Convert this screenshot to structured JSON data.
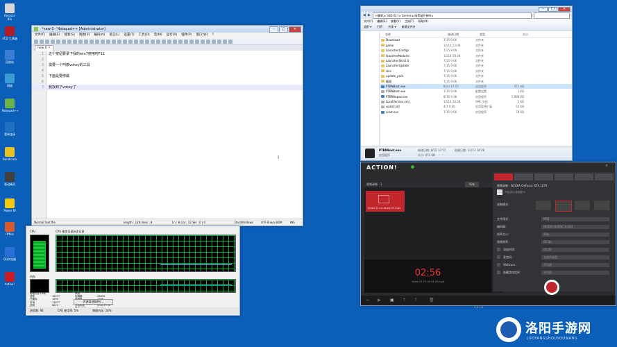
{
  "desktop": {
    "icons": [
      {
        "label": "Recycle Bin",
        "color": "#d8d8d8"
      },
      {
        "label": "ACD 工具箱",
        "color": "#b31b25"
      },
      {
        "label": "回收站",
        "color": "#3a7bd5"
      },
      {
        "label": "网络",
        "color": "#3a9bd5"
      },
      {
        "label": "Notepad++",
        "color": "#6bb34a"
      },
      {
        "label": "宽带连接",
        "color": "#1f6fc2"
      },
      {
        "label": "Bandicam",
        "color": "#e8c020"
      },
      {
        "label": "驱动精灵",
        "color": "#404040"
      },
      {
        "label": "Power BI",
        "color": "#f2c811"
      },
      {
        "label": "Office",
        "color": "#d65a2b"
      },
      {
        "label": "QQ浏览器",
        "color": "#2a6ed8"
      },
      {
        "label": "Action!",
        "color": "#c81c22"
      }
    ]
  },
  "notepad": {
    "title": "*new 0 - Notepad++ [Administrator]",
    "menu": [
      "文件(F)",
      "编辑(E)",
      "搜索(S)",
      "视图(V)",
      "编码(N)",
      "语言(L)",
      "设置(T)",
      "工具(O)",
      "宏(M)",
      "运行(R)",
      "插件(P)",
      "窗口(W)",
      "?"
    ],
    "tab": "new 0",
    "lines": [
      {
        "n": "1",
        "text": "这个按钮要录下我的win7使用时F11"
      },
      {
        "n": "2",
        "text": ""
      },
      {
        "n": "3",
        "text": "需要一个叫做vokey的工具"
      },
      {
        "n": "4",
        "text": ""
      },
      {
        "n": "5",
        "text": "下面是要修磁"
      },
      {
        "n": "6",
        "text": ""
      },
      {
        "n": "7",
        "text": "我找到了vokey了"
      }
    ],
    "status": {
      "type": "Normal text file",
      "length": "length : 126    lines : 8",
      "pos": "Ln : 8    Col : 12    Sel : 0 | 0",
      "eol": "Dos\\Windows",
      "enc": "UTF-8 w/o BOM",
      "mode": "INS"
    }
  },
  "taskmgr": {
    "cpu_label": "CPU",
    "history_label": "CPU 使用记录历史记录",
    "mem_label": "内存",
    "mem_history_label": "物理内存使用记录",
    "stats_left": [
      {
        "k": "物理内存 (MB)",
        "v": ""
      },
      {
        "k": "总数",
        "v": "16377"
      },
      {
        "k": "已缓存",
        "v": "1894"
      },
      {
        "k": "可用",
        "v": "13677"
      },
      {
        "k": "空闲",
        "v": "8874"
      }
    ],
    "stats_right": [
      {
        "k": "系统",
        "v": ""
      },
      {
        "k": "句柄数",
        "v": "29854"
      },
      {
        "k": "线程数",
        "v": "1298"
      },
      {
        "k": "进程数",
        "v": "92"
      },
      {
        "k": "开机时间",
        "v": "0:00:17:32"
      },
      {
        "k": "提交 (GB)",
        "v": "2 / 31"
      }
    ],
    "kernel_label": "核心内存 (MB)",
    "kernel": [
      {
        "k": "分页数",
        "v": "200"
      },
      {
        "k": "未分页",
        "v": "126"
      }
    ],
    "resmon_button": "资源监视器(R)...",
    "status": [
      "进程数: 92",
      "CPU 使用率: 5%",
      "物理内存: 16%"
    ]
  },
  "explorer": {
    "address": "计算机 ▸ SSD (D:) ▸ Games ▸ 暗黑破坏神III ▸",
    "menu": [
      "文件(F)",
      "编辑(E)",
      "查看(V)",
      "工具(T)",
      "帮助(H)"
    ],
    "commands": [
      "组织 ▾",
      "打开",
      "共享 ▾",
      "新建文件夹"
    ],
    "columns": [
      "名称",
      "修改日期",
      "类型",
      "大小"
    ],
    "files": [
      {
        "name": "Download",
        "date": "7/15 9:06",
        "type": "文件夹",
        "size": "",
        "kind": "folder"
      },
      {
        "name": "game",
        "date": "12/14 13:06",
        "type": "文件夹",
        "size": "",
        "kind": "folder"
      },
      {
        "name": "LauncherConfigs",
        "date": "7/15 9:06",
        "type": "文件夹",
        "size": "",
        "kind": "folder"
      },
      {
        "name": "launcherModules",
        "date": "12/14 18:28",
        "type": "文件夹",
        "size": "",
        "kind": "folder"
      },
      {
        "name": "LauncherSkin2.0",
        "date": "7/15 9:06",
        "type": "文件夹",
        "size": "",
        "kind": "folder"
      },
      {
        "name": "LauncherUpdate",
        "date": "7/15 9:06",
        "type": "文件夹",
        "size": "",
        "kind": "folder"
      },
      {
        "name": "skin",
        "date": "7/15 9:06",
        "type": "文件夹",
        "size": "",
        "kind": "folder"
      },
      {
        "name": "update_pack",
        "date": "7/15 9:06",
        "type": "文件夹",
        "size": "",
        "kind": "folder"
      },
      {
        "name": "截图",
        "date": "7/15 9:06",
        "type": "文件夹",
        "size": "",
        "kind": "folder"
      },
      {
        "name": "PTBNBoot.exe",
        "date": "8/22 17:57",
        "type": "应用程序",
        "size": "471 KB",
        "kind": "exe",
        "sel": true
      },
      {
        "name": "PTBNBoot.exe",
        "date": "7/15 9:06",
        "type": "配置设置",
        "size": "1 KB",
        "kind": "dll"
      },
      {
        "name": "PTBNRepair.exe",
        "date": "8/16 9:38",
        "type": "应用程序",
        "size": "2,888 KB",
        "kind": "exe"
      },
      {
        "name": "LocalVersion.xml",
        "date": "12/14 18:28",
        "type": "XML 文档",
        "size": "1 KB",
        "kind": "dll"
      },
      {
        "name": "vpatch.dll",
        "date": "4/3 9:46",
        "type": "应用程序扩展",
        "size": "53 KB",
        "kind": "dll"
      },
      {
        "name": "xinst.exe",
        "date": "7/15 9:06",
        "type": "应用程序",
        "size": "78 KB",
        "kind": "exe"
      }
    ],
    "details": {
      "name": "PTBNBoot.exe",
      "modified": "修改日期: 8/22 17:57",
      "created": "创建日期: 12/13 14:28",
      "type": "应用程序",
      "size": "大小: 471 KB"
    }
  },
  "action": {
    "logo": "ACTION!",
    "left_header": "视频录制 · 1",
    "filter": "所有",
    "selected_clip": "Video 12-13 18-04-03.mp4",
    "timer": "02:56",
    "timer_sub": "Video 12-13 18-04-03.mp4",
    "size": "4.8 GB",
    "right_title": "视频录制 - NVIDIA GeForce GTX 1070",
    "right_sub": "开启/停止录制按F9",
    "mode_label": "录制模式：",
    "settings": [
      {
        "k": "文件格式：",
        "v": "MP4"
      },
      {
        "k": "编码器：",
        "v": "NVIDIA NVENC H.264"
      },
      {
        "k": "帧率大小：",
        "v": "原始"
      },
      {
        "k": "视频帧率：",
        "v": "60 fps"
      },
      {
        "k": "添加时间：",
        "v": "00:00"
      },
      {
        "k": "麦克风：",
        "v": "立体声混音"
      },
      {
        "k": "Webcam：",
        "v": "不可用"
      },
      {
        "k": "隐藏游戏程序：",
        "v": "不可用"
      }
    ]
  },
  "watermark": {
    "title": "洛阳手游网",
    "sub": "LUOYANGSHOUYOUWANG"
  },
  "colors": {
    "desktop": "#0b5fb8",
    "action_red": "#c1272d"
  }
}
